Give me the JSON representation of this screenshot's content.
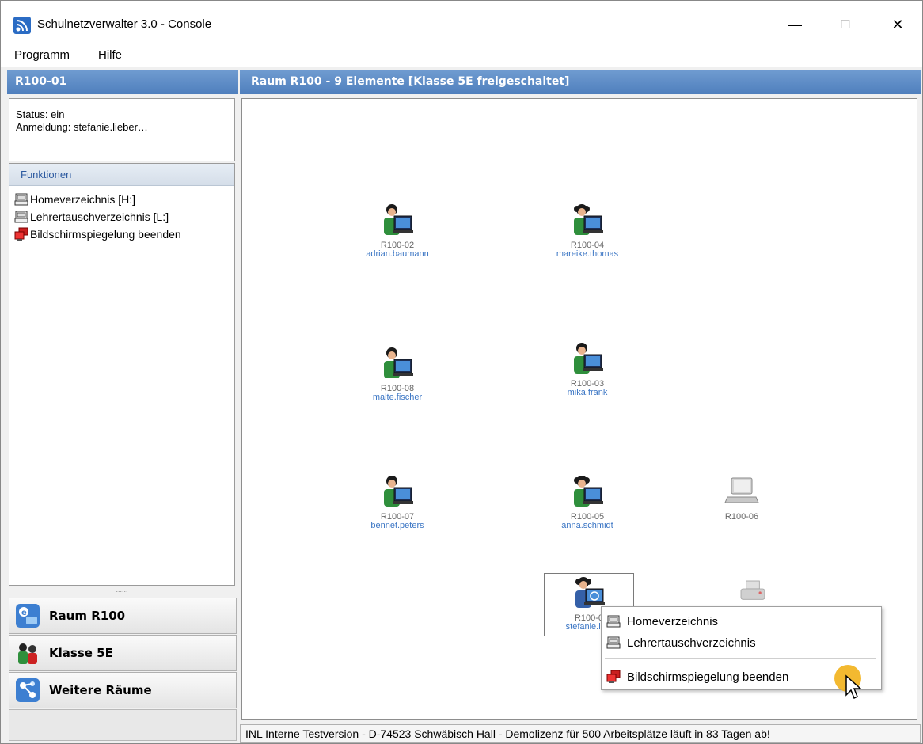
{
  "window": {
    "title": "Schulnetzverwalter 3.0 - Console",
    "minimize_label": "—",
    "maximize_label": "☐",
    "close_label": "✕"
  },
  "menu": {
    "items": [
      "Programm",
      "Hilfe"
    ]
  },
  "left": {
    "header": "R100-01",
    "status_line": "Status: ein",
    "login_line": "Anmeldung: stefanie.lieber…",
    "functions_header": "Funktionen",
    "functions": [
      {
        "label": "Homeverzeichnis [H:]",
        "icon": "network-drive-icon"
      },
      {
        "label": "Lehrertauschverzeichnis [L:]",
        "icon": "network-drive-icon"
      },
      {
        "label": "Bildschirmspiegelung beenden",
        "icon": "screen-mirror-stop-icon"
      }
    ],
    "splitter_grip": "......",
    "nav": [
      {
        "label": "Raum R100",
        "icon": "room-icon"
      },
      {
        "label": "Klasse 5E",
        "icon": "class-icon"
      },
      {
        "label": "Weitere Räume",
        "icon": "more-rooms-icon"
      }
    ]
  },
  "right": {
    "header": "Raum R100 - 9 Elemente [Klasse 5E freigeschaltet]",
    "stations": [
      {
        "name": "R100-02",
        "user": "adrian.baumann",
        "type": "student-male"
      },
      {
        "name": "R100-04",
        "user": "mareike.thomas",
        "type": "student-female"
      },
      {
        "name": "R100-08",
        "user": "malte.fischer",
        "type": "student-male"
      },
      {
        "name": "R100-03",
        "user": "mika.frank",
        "type": "student-male"
      },
      {
        "name": "R100-07",
        "user": "bennet.peters",
        "type": "student-male"
      },
      {
        "name": "R100-05",
        "user": "anna.schmidt",
        "type": "student-female"
      },
      {
        "name": "R100-06",
        "user": "",
        "type": "laptop-off"
      },
      {
        "name": "R100-01",
        "user": "stefanie.lieber",
        "type": "teacher-selected"
      },
      {
        "name": "",
        "user": "",
        "type": "printer"
      }
    ],
    "selected_station_name_visible": "R100-0",
    "selected_station_user_visible": "stefanie.lieb"
  },
  "context_menu": {
    "items": [
      {
        "label": "Homeverzeichnis",
        "icon": "network-drive-icon"
      },
      {
        "label": "Lehrertauschverzeichnis",
        "icon": "network-drive-icon"
      },
      {
        "label": "Bildschirmspiegelung beenden",
        "icon": "screen-mirror-stop-icon"
      }
    ]
  },
  "statusbar": {
    "text": "INL Interne Testversion - D-74523 Schwäbisch Hall - Demolizenz für 500 Arbeitsplätze läuft in 83 Tagen ab!"
  },
  "colors": {
    "header_blue": "#4f7fbd",
    "link_blue": "#3a75c4",
    "student_green": "#2f8f3c",
    "cursor_highlight": "#f2b525"
  }
}
